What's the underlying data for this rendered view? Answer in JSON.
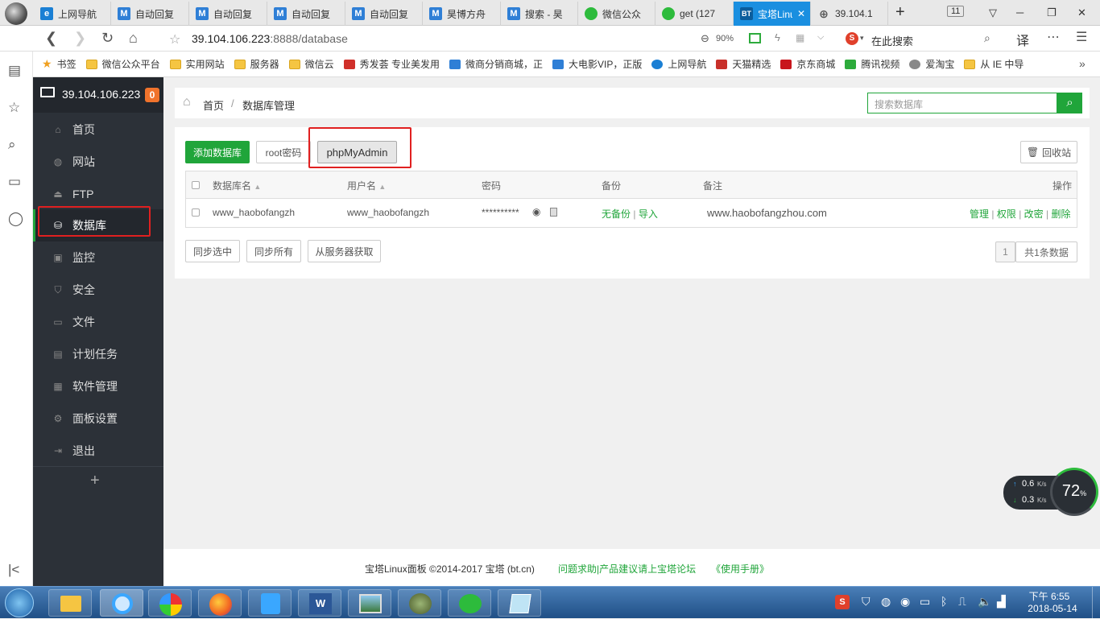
{
  "browser": {
    "tabs": [
      {
        "label": "上网导航",
        "icon": "e"
      },
      {
        "label": "自动回复",
        "icon": "M"
      },
      {
        "label": "自动回复",
        "icon": "M"
      },
      {
        "label": "自动回复",
        "icon": "M"
      },
      {
        "label": "自动回复",
        "icon": "M"
      },
      {
        "label": "昊博方舟",
        "icon": "M"
      },
      {
        "label": "搜索 - 昊",
        "icon": "M"
      },
      {
        "label": "微信公众",
        "icon": "wx"
      },
      {
        "label": "get (127",
        "icon": "wx"
      },
      {
        "label": "宝塔Linu",
        "icon": "BT",
        "active": true
      },
      {
        "label": "39.104.1",
        "icon": "globe"
      }
    ],
    "tab_count": "11",
    "url_host": "39.104.106.223",
    "url_path": ":8888/database",
    "zoom": "90%",
    "search_placeholder": "在此搜索",
    "translate_label": "译",
    "bookmarks": [
      {
        "label": "书签",
        "icon": "star"
      },
      {
        "label": "微信公众平台",
        "icon": "folder"
      },
      {
        "label": "实用网站",
        "icon": "folder"
      },
      {
        "label": "服务器",
        "icon": "folder"
      },
      {
        "label": "微信云",
        "icon": "folder"
      },
      {
        "label": "秀发荟 专业美发用",
        "icon": "red"
      },
      {
        "label": "微商分销商城，正",
        "icon": "M"
      },
      {
        "label": "大电影VIP，正版",
        "icon": "M"
      },
      {
        "label": "上网导航",
        "icon": "e"
      },
      {
        "label": "天猫精选",
        "icon": "tmall"
      },
      {
        "label": "京东商城",
        "icon": "jd"
      },
      {
        "label": "腾讯视频",
        "icon": "play"
      },
      {
        "label": "爱淘宝",
        "icon": "globe"
      },
      {
        "label": "从 IE 中导",
        "icon": "folder"
      }
    ]
  },
  "sidebar": {
    "server_ip": "39.104.106.223",
    "badge": "0",
    "items": [
      {
        "label": "首页",
        "icon": "home-icon"
      },
      {
        "label": "网站",
        "icon": "globe-icon"
      },
      {
        "label": "FTP",
        "icon": "ftp-icon"
      },
      {
        "label": "数据库",
        "icon": "database-icon",
        "active": true
      },
      {
        "label": "监控",
        "icon": "monitor-icon"
      },
      {
        "label": "安全",
        "icon": "shield-icon"
      },
      {
        "label": "文件",
        "icon": "folder-icon"
      },
      {
        "label": "计划任务",
        "icon": "calendar-icon"
      },
      {
        "label": "软件管理",
        "icon": "grid-icon"
      },
      {
        "label": "面板设置",
        "icon": "gear-icon"
      },
      {
        "label": "退出",
        "icon": "logout-icon"
      }
    ],
    "add_label": "+"
  },
  "main": {
    "breadcrumb": {
      "home": "首页",
      "sep": "/",
      "current": "数据库管理"
    },
    "search_placeholder": "搜索数据库",
    "buttons": {
      "add_db": "添加数据库",
      "root_pw": "root密码",
      "phpmyadmin": "phpMyAdmin",
      "recycle": "回收站"
    },
    "table": {
      "headers": [
        "数据库名",
        "用户名",
        "密码",
        "备份",
        "备注",
        "操作"
      ],
      "rows": [
        {
          "name": "www_haobofangzh",
          "user": "www_haobofangzh",
          "password": "**********",
          "backup_none": "无备份",
          "backup_sep": "|",
          "import": "导入",
          "note": "www.haobofangzhou.com",
          "actions": [
            "管理",
            "权限",
            "改密",
            "删除"
          ]
        }
      ]
    },
    "footer_buttons": [
      "同步选中",
      "同步所有",
      "从服务器获取"
    ],
    "pager": {
      "page": "1",
      "total": "共1条数据"
    },
    "footer": {
      "copyright": "宝塔Linux面板 ©2014-2017 宝塔 (bt.cn)",
      "forum": "问题求助|产品建议请上宝塔论坛",
      "manual": "《使用手册》"
    }
  },
  "speed_widget": {
    "up": "0.6",
    "up_unit": "K/s",
    "down": "0.3",
    "down_unit": "K/s",
    "percent": "72",
    "percent_unit": "%"
  },
  "taskbar": {
    "time": "下午 6:55",
    "date": "2018-05-14"
  },
  "colors": {
    "accent": "#20a53a",
    "sidebar": "#2c3138",
    "tab_active": "#1a8fe0",
    "highlight_box": "#e02020"
  }
}
